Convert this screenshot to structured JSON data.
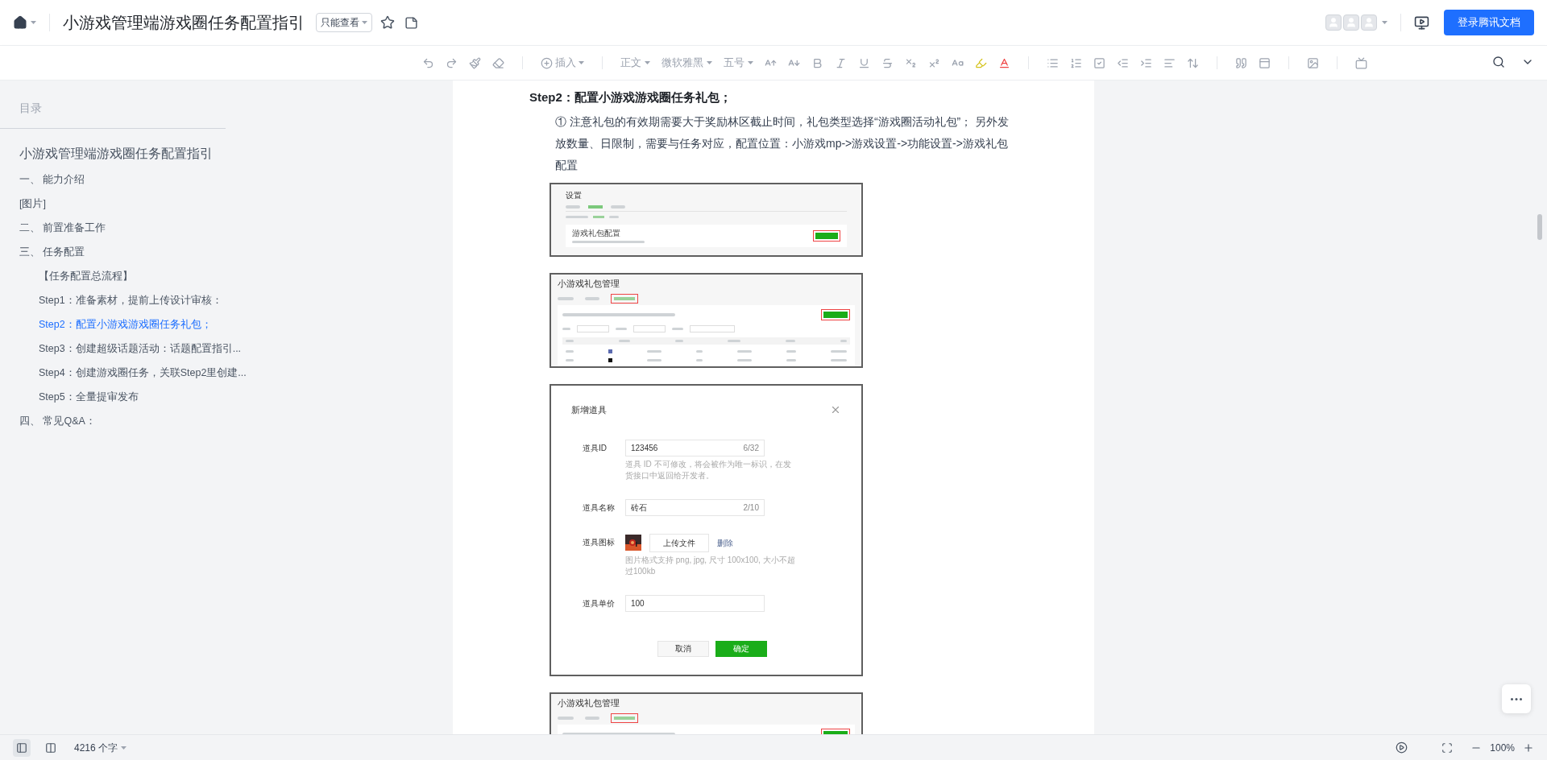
{
  "topbar": {
    "title": "小游戏管理端游戏圈任务配置指引",
    "permission": "只能查看",
    "login_button": "登录腾讯文档"
  },
  "toolbar": {
    "insert": "插入",
    "paragraph_style": "正文",
    "font": "微软雅黑",
    "font_size": "五号"
  },
  "outline": {
    "heading": "目录",
    "title": "小游戏管理端游戏圈任务配置指引",
    "items": [
      {
        "text": "一、 能力介绍",
        "selected": false
      },
      {
        "text": "[图片]",
        "selected": false
      },
      {
        "text": "二、 前置准备工作",
        "selected": false
      },
      {
        "text": "三、 任务配置",
        "selected": false,
        "children": [
          {
            "text": "【任务配置总流程】",
            "selected": false
          },
          {
            "text": "Step1：准备素材，提前上传设计审核：",
            "selected": false
          },
          {
            "text": "Step2：配置小游戏游戏圈任务礼包；",
            "selected": true
          },
          {
            "text": "Step3：创建超级话题活动：话题配置指引...",
            "selected": false
          },
          {
            "text": "Step4：创建游戏圈任务，关联Step2里创建...",
            "selected": false
          },
          {
            "text": "Step5：全量提审发布",
            "selected": false
          }
        ]
      },
      {
        "text": "四、 常见Q&A：",
        "selected": false
      }
    ]
  },
  "document": {
    "heading": "Step2：配置小游戏游戏圈任务礼包；",
    "note": "① 注意礼包的有效期需要大于奖励林区截止时间，礼包类型选择“游戏圈活动礼包”； 另外发放数量、日限制，需要与任务对应，配置位置：小游戏mp->游戏设置->功能设置->游戏礼包配置",
    "images": [
      {
        "kind": "settings",
        "title": "设置",
        "card_title": "游戏礼包配置"
      },
      {
        "kind": "gift_list",
        "title": "小游戏礼包管理"
      },
      {
        "kind": "dialog",
        "title": "新增道具",
        "fields": [
          {
            "kind": "input",
            "label": "道具ID",
            "value": "123456",
            "counter": "6/32",
            "hint": "道具 ID 不可修改，将会被作为唯一标识，在发货接口中返回给开发者。"
          },
          {
            "kind": "input",
            "label": "道具名称",
            "value": "砖石",
            "counter": "2/10"
          },
          {
            "kind": "upload",
            "label": "道具图标",
            "button": "上传文件",
            "link": "删除",
            "hint": "图片格式支持 png, jpg, 尺寸 100x100, 大小不超过100kb"
          },
          {
            "kind": "input",
            "label": "道具单价",
            "value": "100"
          }
        ],
        "cancel": "取消",
        "confirm": "确定"
      },
      {
        "kind": "gift_list_partial",
        "title": "小游戏礼包管理"
      }
    ]
  },
  "status_bar": {
    "word_count": "4216 个字",
    "zoom": "100%"
  }
}
